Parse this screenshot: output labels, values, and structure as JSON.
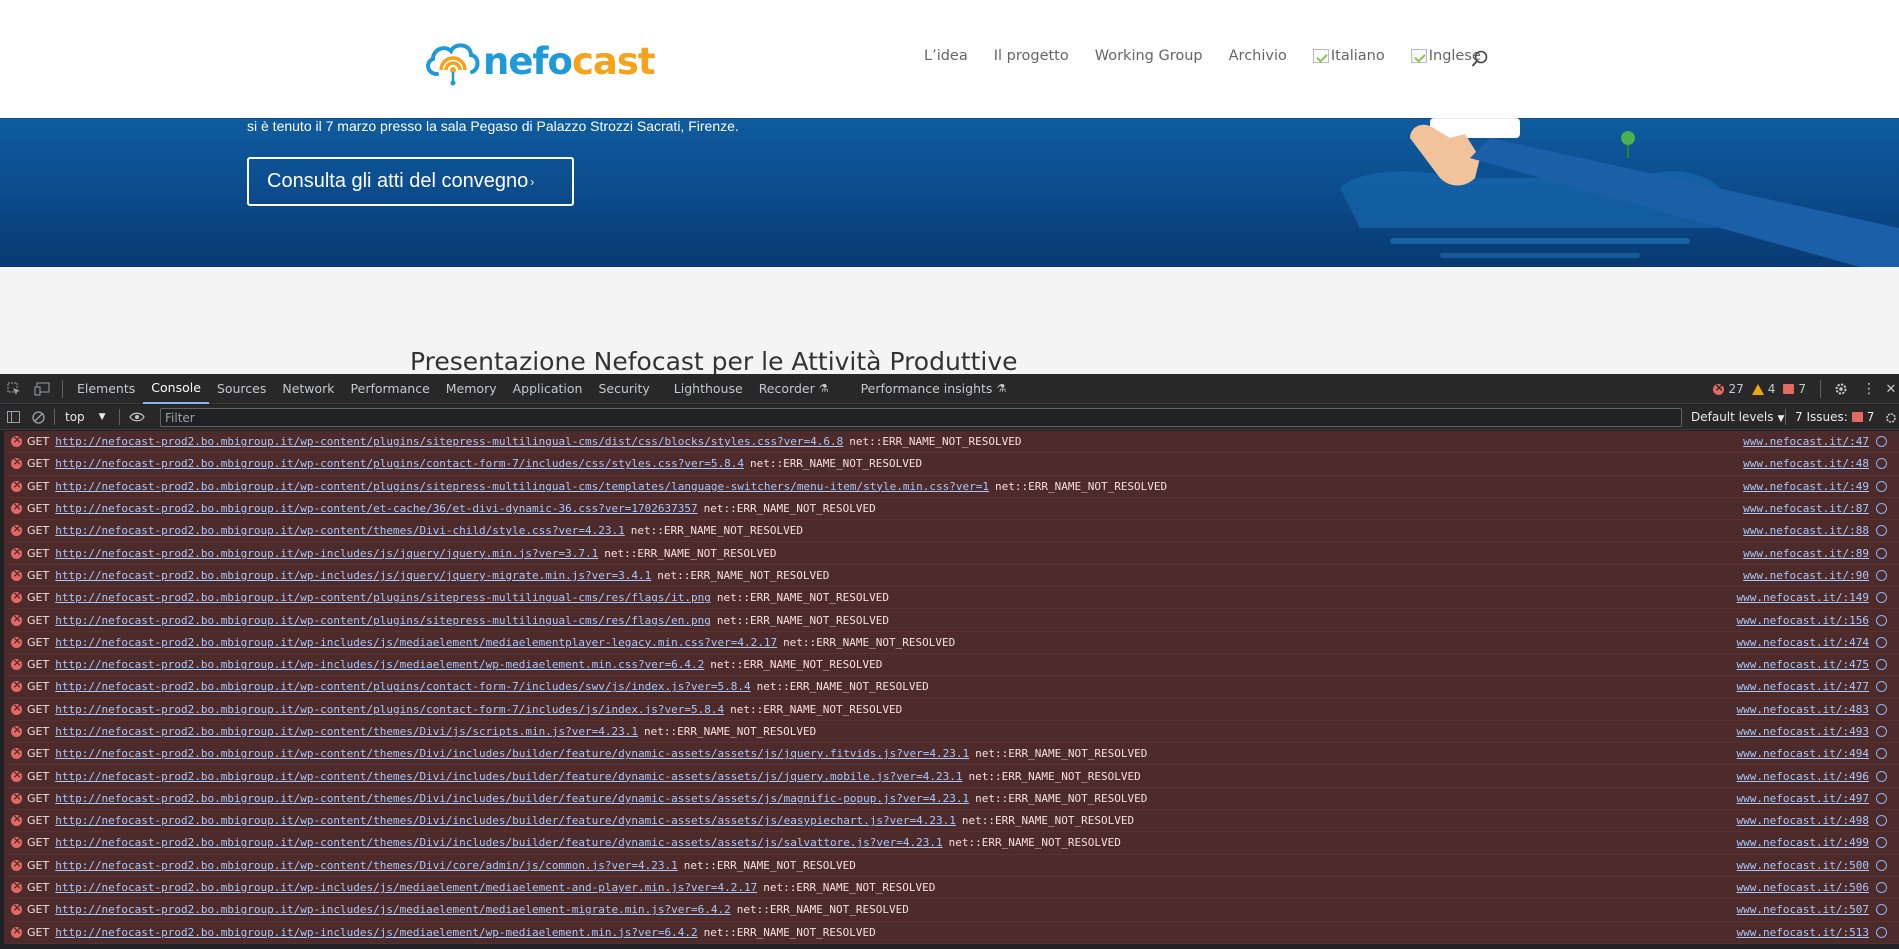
{
  "site": {
    "logo": {
      "part1": "nefo",
      "part2": "cast"
    },
    "nav": [
      "L’idea",
      "Il progetto",
      "Working Group",
      "Archivio"
    ],
    "lang": [
      "Italiano",
      "Inglese"
    ],
    "hero_text": "si è tenuto il 7 marzo presso la sala Pegaso di Palazzo Strozzi Sacrati, Firenze.",
    "hero_button": "Consulta gli atti del convegno",
    "section_title": "Presentazione Nefocast per le Attività Produttive",
    "colors": {
      "logo_blue": "#1e9bd7",
      "logo_orange": "#f5a31a",
      "hero_blue": "#0b4a8a"
    }
  },
  "devtools": {
    "tabs": [
      "Elements",
      "Console",
      "Sources",
      "Network",
      "Performance",
      "Memory",
      "Application",
      "Security",
      "Lighthouse",
      "Recorder",
      "Performance insights"
    ],
    "active_tab": "Console",
    "counts": {
      "errors": "27",
      "warnings": "4",
      "messages": "7"
    },
    "context": "top",
    "filter_placeholder": "Filter",
    "levels": "Default levels",
    "issues_label": "7 Issues:",
    "issues_count": "7",
    "logs": [
      {
        "method": "GET",
        "url": "http://nefocast-prod2.bo.mbigroup.it/wp-content/plugins/sitepress-multilingual-cms/dist/css/blocks/styles.css?ver=4.6.8",
        "status": "net::ERR_NAME_NOT_RESOLVED",
        "src": "www.nefocast.it/:47"
      },
      {
        "method": "GET",
        "url": "http://nefocast-prod2.bo.mbigroup.it/wp-content/plugins/contact-form-7/includes/css/styles.css?ver=5.8.4",
        "status": "net::ERR_NAME_NOT_RESOLVED",
        "src": "www.nefocast.it/:48"
      },
      {
        "method": "GET",
        "url": "http://nefocast-prod2.bo.mbigroup.it/wp-content/plugins/sitepress-multilingual-cms/templates/language-switchers/menu-item/style.min.css?ver=1",
        "status": "net::ERR_NAME_NOT_RESOLVED",
        "src": "www.nefocast.it/:49"
      },
      {
        "method": "GET",
        "url": "http://nefocast-prod2.bo.mbigroup.it/wp-content/et-cache/36/et-divi-dynamic-36.css?ver=1702637357",
        "status": "net::ERR_NAME_NOT_RESOLVED",
        "src": "www.nefocast.it/:87"
      },
      {
        "method": "GET",
        "url": "http://nefocast-prod2.bo.mbigroup.it/wp-content/themes/Divi-child/style.css?ver=4.23.1",
        "status": "net::ERR_NAME_NOT_RESOLVED",
        "src": "www.nefocast.it/:88"
      },
      {
        "method": "GET",
        "url": "http://nefocast-prod2.bo.mbigroup.it/wp-includes/js/jquery/jquery.min.js?ver=3.7.1",
        "status": "net::ERR_NAME_NOT_RESOLVED",
        "src": "www.nefocast.it/:89"
      },
      {
        "method": "GET",
        "url": "http://nefocast-prod2.bo.mbigroup.it/wp-includes/js/jquery/jquery-migrate.min.js?ver=3.4.1",
        "status": "net::ERR_NAME_NOT_RESOLVED",
        "src": "www.nefocast.it/:90"
      },
      {
        "method": "GET",
        "url": "http://nefocast-prod2.bo.mbigroup.it/wp-content/plugins/sitepress-multilingual-cms/res/flags/it.png",
        "status": "net::ERR_NAME_NOT_RESOLVED",
        "src": "www.nefocast.it/:149"
      },
      {
        "method": "GET",
        "url": "http://nefocast-prod2.bo.mbigroup.it/wp-content/plugins/sitepress-multilingual-cms/res/flags/en.png",
        "status": "net::ERR_NAME_NOT_RESOLVED",
        "src": "www.nefocast.it/:156"
      },
      {
        "method": "GET",
        "url": "http://nefocast-prod2.bo.mbigroup.it/wp-includes/js/mediaelement/mediaelementplayer-legacy.min.css?ver=4.2.17",
        "status": "net::ERR_NAME_NOT_RESOLVED",
        "src": "www.nefocast.it/:474"
      },
      {
        "method": "GET",
        "url": "http://nefocast-prod2.bo.mbigroup.it/wp-includes/js/mediaelement/wp-mediaelement.min.css?ver=6.4.2",
        "status": "net::ERR_NAME_NOT_RESOLVED",
        "src": "www.nefocast.it/:475"
      },
      {
        "method": "GET",
        "url": "http://nefocast-prod2.bo.mbigroup.it/wp-content/plugins/contact-form-7/includes/swv/js/index.js?ver=5.8.4",
        "status": "net::ERR_NAME_NOT_RESOLVED",
        "src": "www.nefocast.it/:477"
      },
      {
        "method": "GET",
        "url": "http://nefocast-prod2.bo.mbigroup.it/wp-content/plugins/contact-form-7/includes/js/index.js?ver=5.8.4",
        "status": "net::ERR_NAME_NOT_RESOLVED",
        "src": "www.nefocast.it/:483"
      },
      {
        "method": "GET",
        "url": "http://nefocast-prod2.bo.mbigroup.it/wp-content/themes/Divi/js/scripts.min.js?ver=4.23.1",
        "status": "net::ERR_NAME_NOT_RESOLVED",
        "src": "www.nefocast.it/:493"
      },
      {
        "method": "GET",
        "url": "http://nefocast-prod2.bo.mbigroup.it/wp-content/themes/Divi/includes/builder/feature/dynamic-assets/assets/js/jquery.fitvids.js?ver=4.23.1",
        "status": "net::ERR_NAME_NOT_RESOLVED",
        "src": "www.nefocast.it/:494"
      },
      {
        "method": "GET",
        "url": "http://nefocast-prod2.bo.mbigroup.it/wp-content/themes/Divi/includes/builder/feature/dynamic-assets/assets/js/jquery.mobile.js?ver=4.23.1",
        "status": "net::ERR_NAME_NOT_RESOLVED",
        "src": "www.nefocast.it/:496"
      },
      {
        "method": "GET",
        "url": "http://nefocast-prod2.bo.mbigroup.it/wp-content/themes/Divi/includes/builder/feature/dynamic-assets/assets/js/magnific-popup.js?ver=4.23.1",
        "status": "net::ERR_NAME_NOT_RESOLVED",
        "src": "www.nefocast.it/:497"
      },
      {
        "method": "GET",
        "url": "http://nefocast-prod2.bo.mbigroup.it/wp-content/themes/Divi/includes/builder/feature/dynamic-assets/assets/js/easypiechart.js?ver=4.23.1",
        "status": "net::ERR_NAME_NOT_RESOLVED",
        "src": "www.nefocast.it/:498"
      },
      {
        "method": "GET",
        "url": "http://nefocast-prod2.bo.mbigroup.it/wp-content/themes/Divi/includes/builder/feature/dynamic-assets/assets/js/salvattore.js?ver=4.23.1",
        "status": "net::ERR_NAME_NOT_RESOLVED",
        "src": "www.nefocast.it/:499"
      },
      {
        "method": "GET",
        "url": "http://nefocast-prod2.bo.mbigroup.it/wp-content/themes/Divi/core/admin/js/common.js?ver=4.23.1",
        "status": "net::ERR_NAME_NOT_RESOLVED",
        "src": "www.nefocast.it/:500"
      },
      {
        "method": "GET",
        "url": "http://nefocast-prod2.bo.mbigroup.it/wp-includes/js/mediaelement/mediaelement-and-player.min.js?ver=4.2.17",
        "status": "net::ERR_NAME_NOT_RESOLVED",
        "src": "www.nefocast.it/:506"
      },
      {
        "method": "GET",
        "url": "http://nefocast-prod2.bo.mbigroup.it/wp-includes/js/mediaelement/mediaelement-migrate.min.js?ver=6.4.2",
        "status": "net::ERR_NAME_NOT_RESOLVED",
        "src": "www.nefocast.it/:507"
      },
      {
        "method": "GET",
        "url": "http://nefocast-prod2.bo.mbigroup.it/wp-includes/js/mediaelement/wp-mediaelement.min.js?ver=6.4.2",
        "status": "net::ERR_NAME_NOT_RESOLVED",
        "src": "www.nefocast.it/:513"
      }
    ],
    "colors": {
      "panel_bg": "#202124",
      "error_row_bg": "#4e2b2b",
      "link": "#a8c7fa",
      "error": "#e46962",
      "warning": "#f2a60d"
    }
  }
}
